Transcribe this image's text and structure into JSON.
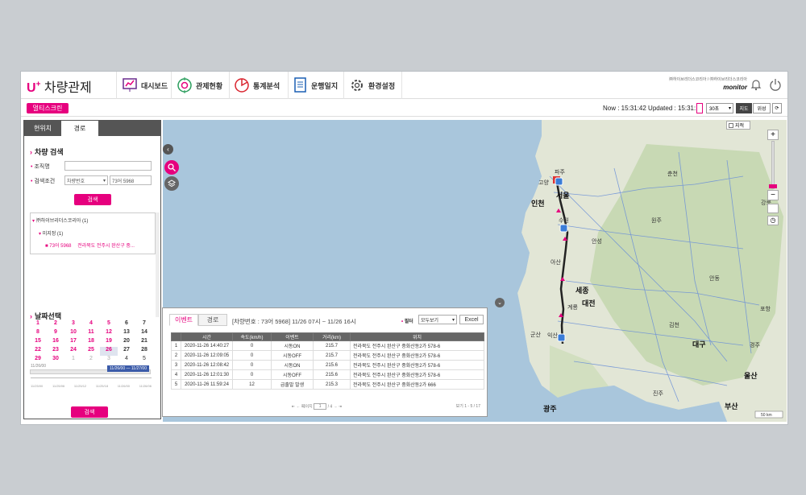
{
  "brand": {
    "prefix": "U",
    "plus": "+",
    "name": "차량관제"
  },
  "nav": [
    {
      "label": "대시보드",
      "icon": "dashboard-icon"
    },
    {
      "label": "관제현황",
      "icon": "target-icon"
    },
    {
      "label": "통계분석",
      "icon": "pie-chart-icon"
    },
    {
      "label": "운행일지",
      "icon": "document-icon"
    },
    {
      "label": "환경설정",
      "icon": "gear-icon"
    }
  ],
  "company": {
    "line1": "㈜하이브리더스코리아 / ㈜하이브리더스코리아",
    "brand": "monitor"
  },
  "subbar": {
    "multiscreen": "멀티스크린",
    "status": "Now : 15:31:42  Updated : 15:31:18",
    "interval": "30초",
    "map_btn": "지도",
    "satellite_btn": "위성",
    "cadastral": "지적"
  },
  "left": {
    "tabs": [
      "현위치",
      "경로"
    ],
    "vehicle_search_title": "차량 검색",
    "org_label": "조직명",
    "cond_label": "검색조건",
    "cond_select": "차량번호",
    "cond_value": "73어 5968",
    "search_btn": "검색",
    "tree": {
      "root": "㈜하이브리더스코리아 (1)",
      "group": "미지정 (1)",
      "vehicle": "73어 5968",
      "vehicle_loc": "전라북도 전주시 완산구 중..."
    },
    "date_title": "날짜선택",
    "calendar": [
      [
        "1",
        "2",
        "3",
        "4",
        "5",
        "6",
        "7"
      ],
      [
        "8",
        "9",
        "10",
        "11",
        "12",
        "13",
        "14"
      ],
      [
        "15",
        "16",
        "17",
        "18",
        "19",
        "20",
        "21"
      ],
      [
        "22",
        "23",
        "24",
        "25",
        "26",
        "27",
        "28"
      ],
      [
        "29",
        "30",
        "1",
        "2",
        "3",
        "4",
        "5"
      ]
    ],
    "range_start": "11/26/00",
    "range_label": "11/26/00 — 11/27/00",
    "ticks": [
      "11/25/00",
      "11/25/06",
      "11/25/12",
      "11/25/18",
      "11/26/00",
      "11/26/06"
    ],
    "search_btn2": "검색"
  },
  "map": {
    "labels": {
      "seoul": "서울",
      "incheon": "인천",
      "sejong": "세종",
      "daejeon": "대전",
      "daegu": "대구",
      "ulsan": "울산",
      "busan": "부산",
      "gwangju": "광주",
      "suwon": "수원",
      "anseong": "안성",
      "asan": "아산",
      "iksan": "익산",
      "gyeryong": "계룡",
      "gunsan": "군산",
      "paju": "파주",
      "goyang": "고양",
      "gangneung": "강릉",
      "chuncheon": "춘천",
      "wonju": "원주",
      "andong": "안동",
      "pohang": "포항",
      "gimcheon": "김천",
      "gyeongju": "경주",
      "jinju": "진주"
    },
    "scale": "50 km"
  },
  "events": {
    "tabs": [
      "이벤트",
      "경로"
    ],
    "info": "[차량번호 : 73어 5968] 11/26 07시 ~ 11/26 16시",
    "filter_label": "필터",
    "filter_value": "모두보기",
    "excel": "Excel",
    "columns": [
      "",
      "시간",
      "속도(km/h)",
      "이벤트",
      "거리(km)",
      "위치"
    ],
    "rows": [
      [
        "1",
        "2020-11-26 14:40:27",
        "0",
        "시동ON",
        "215.7",
        "전라북도 전주시 완산구 중화산동2가 578-6"
      ],
      [
        "2",
        "2020-11-26 12:09:05",
        "0",
        "시동OFF",
        "215.7",
        "전라북도 전주시 완산구 중화산동2가 578-6"
      ],
      [
        "3",
        "2020-11-26 12:08:42",
        "0",
        "시동ON",
        "215.6",
        "전라북도 전주시 완산구 중화산동2가 578-6"
      ],
      [
        "4",
        "2020-11-26 12:01:30",
        "0",
        "시동OFF",
        "215.6",
        "전라북도 전주시 완산구 중화산동2가 578-6"
      ],
      [
        "5",
        "2020-11-26 11:59:24",
        "12",
        "급출발 발생",
        "215.3",
        "전라북도 전주시 완산구 중화산동2가 666"
      ]
    ],
    "page_label": "페이지",
    "page_value": "1",
    "page_total": "/ 4",
    "count": "보기 1 - 5 / 17"
  }
}
